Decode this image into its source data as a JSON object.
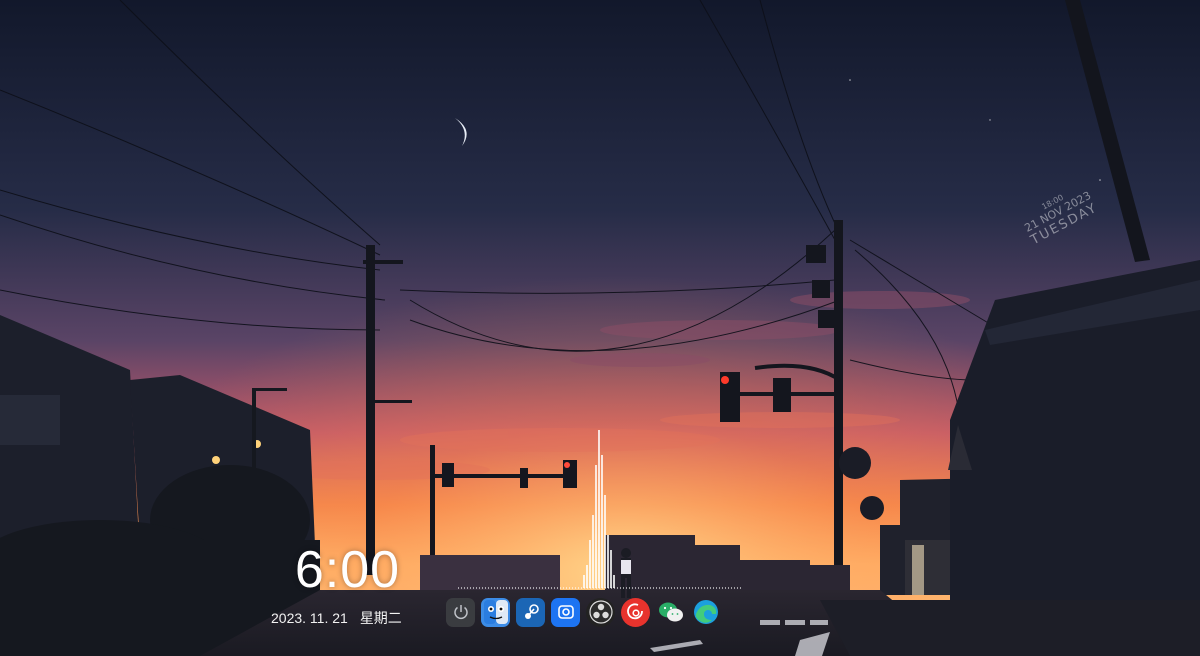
{
  "clock": {
    "time": "6:00"
  },
  "date": {
    "date": "2023. 11. 21",
    "weekday": "星期二"
  },
  "wallpaper_text": {
    "time": "18:00",
    "date": "21 NOV 2023",
    "day": "TUESDAY"
  },
  "dock": {
    "items": [
      {
        "name": "power-icon",
        "color": "#3a3c40"
      },
      {
        "name": "finder-icon",
        "color": "#3c8ce6"
      },
      {
        "name": "steam-icon",
        "color": "#1b66b5"
      },
      {
        "name": "screenshot-app-icon",
        "color": "#1d74f2"
      },
      {
        "name": "obs-icon",
        "color": "#222222"
      },
      {
        "name": "netease-music-icon",
        "color": "#e8332d"
      },
      {
        "name": "wechat-icon",
        "color": "#2aae67"
      },
      {
        "name": "edge-icon",
        "color": "#1ca0dd"
      }
    ]
  },
  "colors": {
    "sky_top": "#141a2c",
    "sky_mid": "#4b3a5c",
    "sunset": "#f08a4a",
    "horizon": "#ffb36b"
  }
}
